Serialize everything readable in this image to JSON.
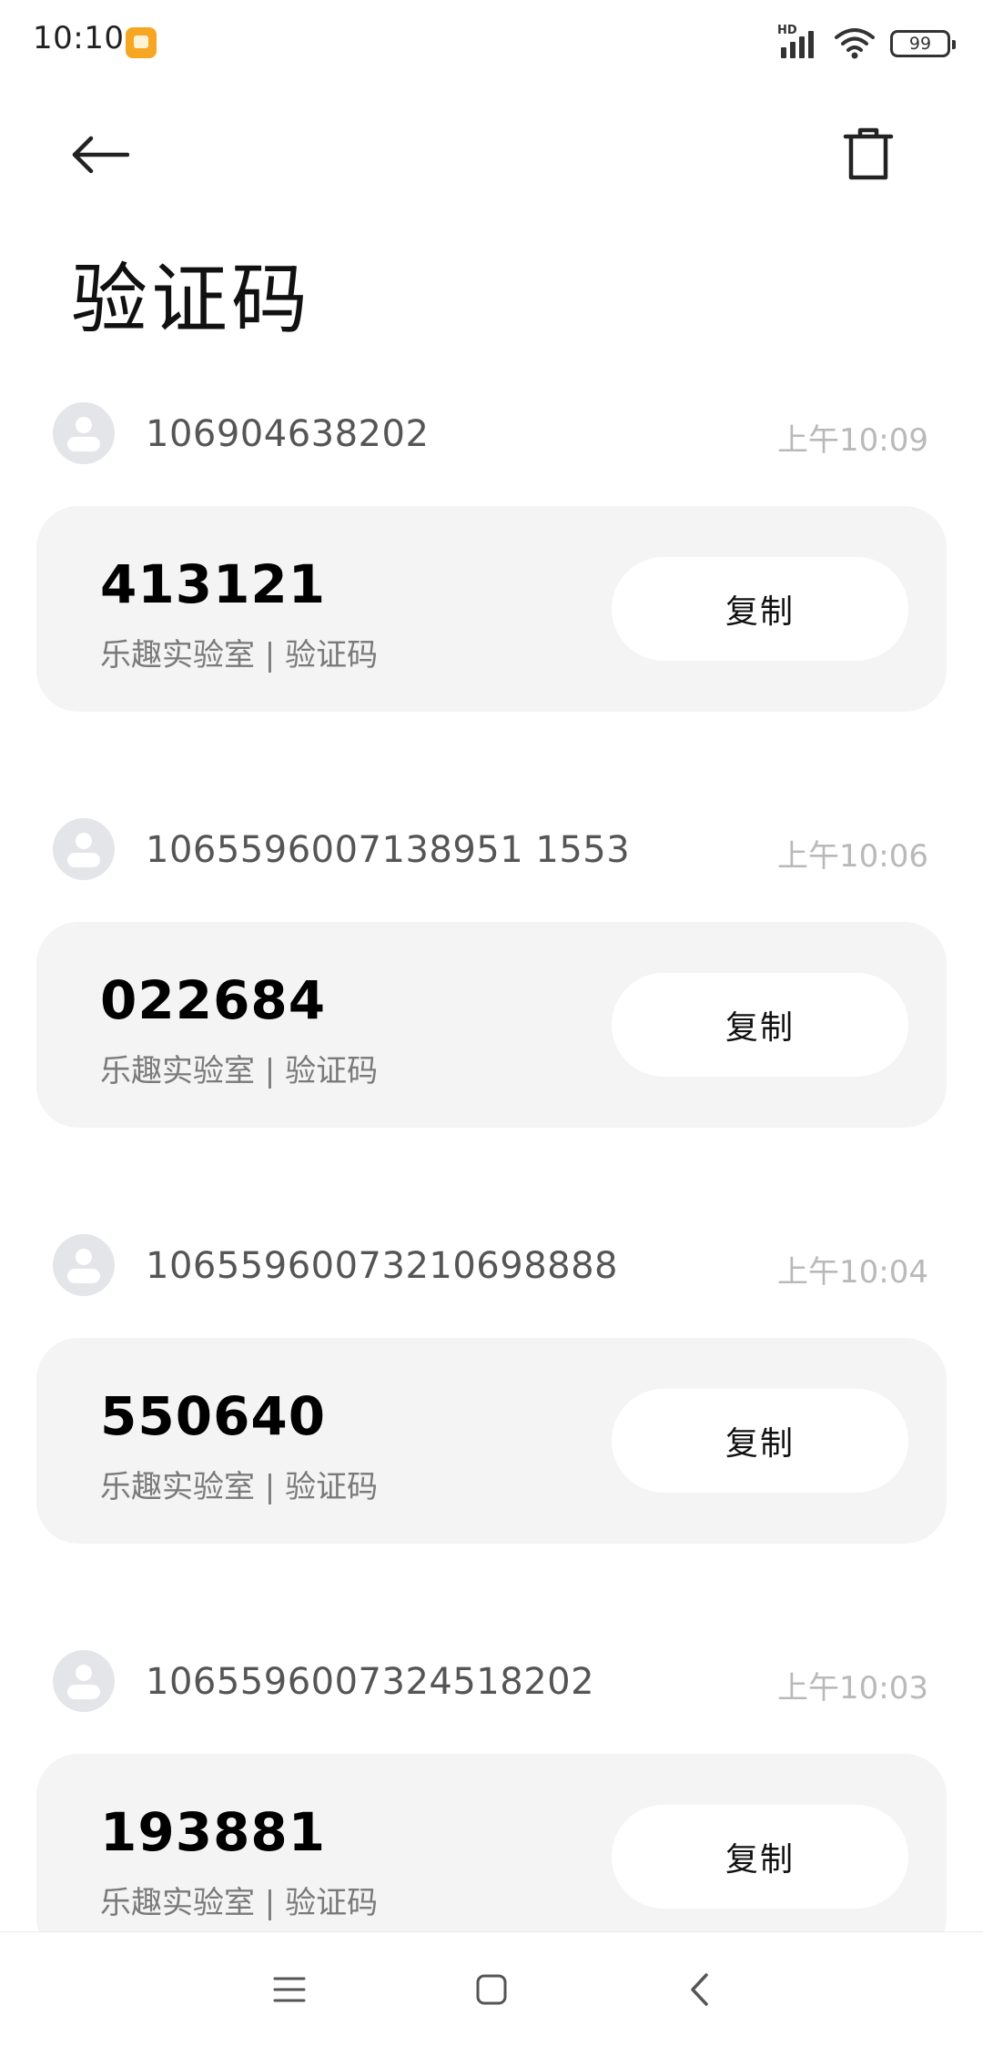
{
  "status_bar": {
    "time": "10:10",
    "signal_label": "HD",
    "battery": "99"
  },
  "header": {
    "title": "验证码"
  },
  "messages": [
    {
      "sender": "106904638202",
      "time": "上午10:09",
      "code": "413121",
      "description": "乐趣实验室 | 验证码",
      "copy_label": "复制"
    },
    {
      "sender": "1065596007138951 1553",
      "time": "上午10:06",
      "code": "022684",
      "description": "乐趣实验室 | 验证码",
      "copy_label": "复制"
    },
    {
      "sender": "10655960073210698888",
      "time": "上午10:04",
      "code": "550640",
      "description": "乐趣实验室 | 验证码",
      "copy_label": "复制"
    },
    {
      "sender": "1065596007324518202",
      "time": "上午10:03",
      "code": "193881",
      "description": "乐趣实验室 | 验证码",
      "copy_label": "复制"
    }
  ],
  "icons": {
    "back": "arrow-left-icon",
    "delete": "trash-icon",
    "nav_menu": "menu-icon",
    "nav_home": "home-icon",
    "nav_back": "chevron-left-icon"
  }
}
